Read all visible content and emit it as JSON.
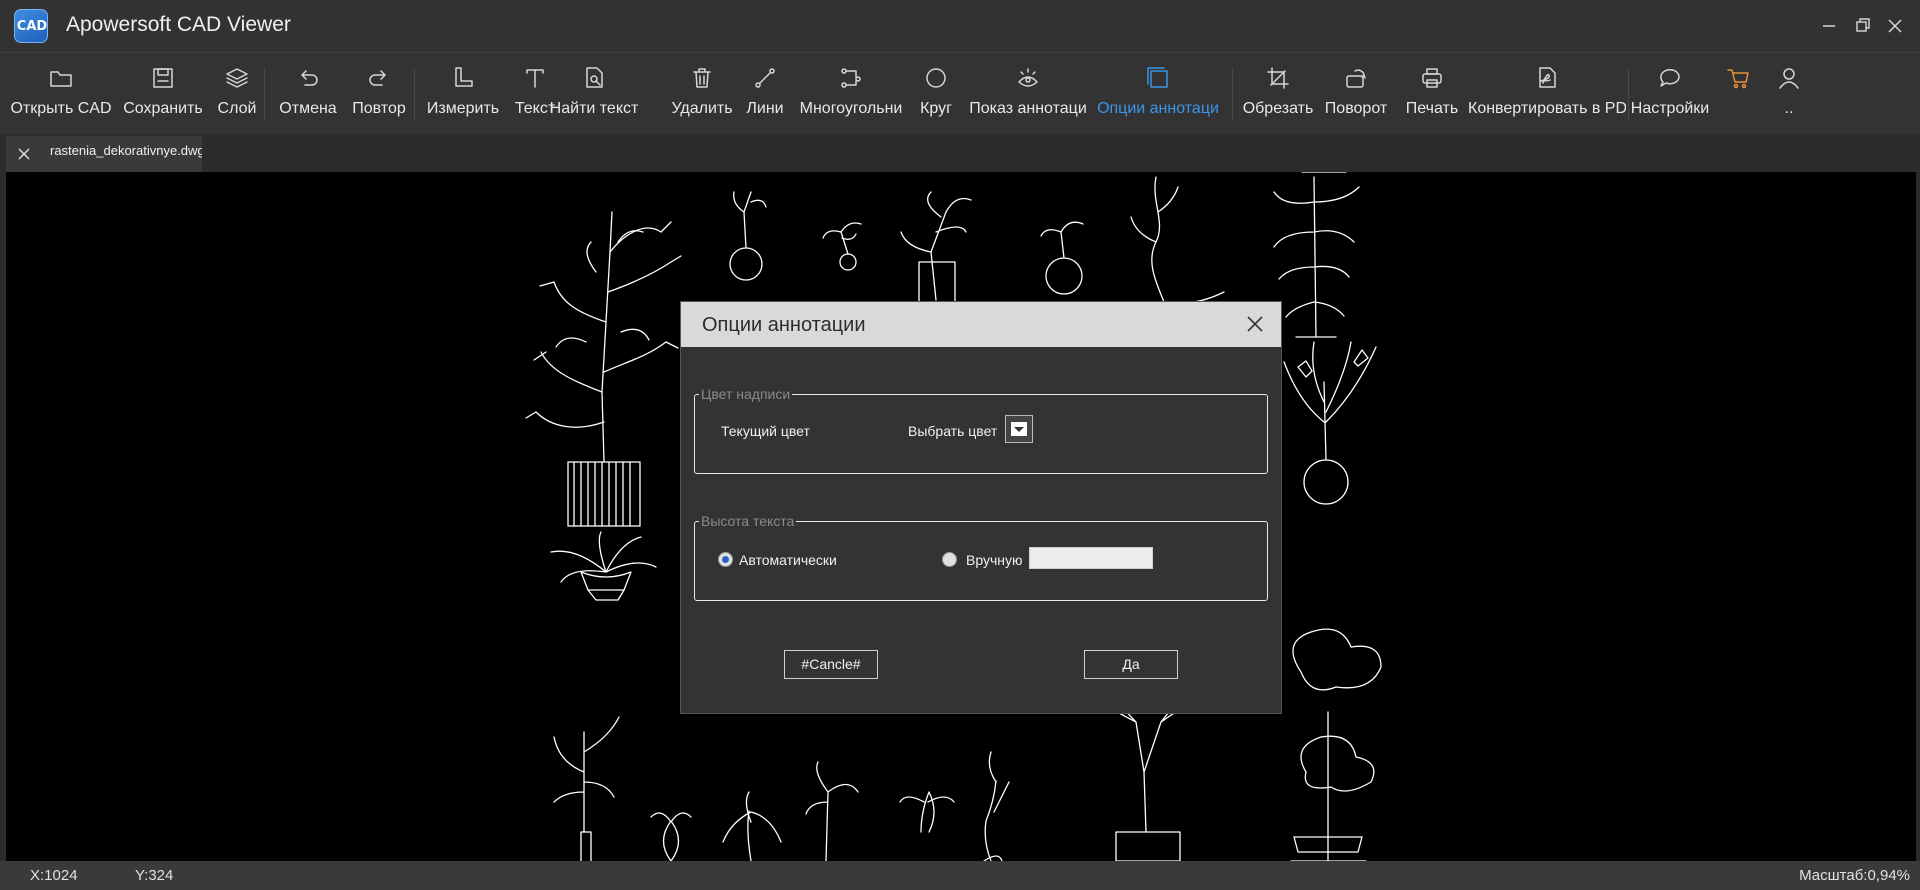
{
  "window": {
    "title": "Apowersoft CAD Viewer",
    "logo_text": "CAD"
  },
  "toolbar": {
    "items": [
      {
        "label": "Открыть CAD",
        "icon": "folder-icon"
      },
      {
        "label": "Сохранить",
        "icon": "save-icon"
      },
      {
        "label": "Слой",
        "icon": "layers-icon"
      },
      {
        "label": "Отмена",
        "icon": "undo-icon"
      },
      {
        "label": "Повтор",
        "icon": "redo-icon"
      },
      {
        "label": "Измерить",
        "icon": "measure-icon"
      },
      {
        "label": "Текст",
        "icon": "text-icon"
      },
      {
        "label": "Найти текст",
        "icon": "find-text-icon"
      },
      {
        "label": "Удалить",
        "icon": "trash-icon"
      },
      {
        "label": "Лини",
        "icon": "line-icon"
      },
      {
        "label": "Многоугольни",
        "icon": "polygon-icon"
      },
      {
        "label": "Круг",
        "icon": "circle-icon"
      },
      {
        "label": "Показ аннотаци",
        "icon": "show-annotation-icon"
      },
      {
        "label": "Опции аннотаци",
        "icon": "annotation-options-icon",
        "active": true
      },
      {
        "label": "Обрезать",
        "icon": "crop-icon"
      },
      {
        "label": "Поворот",
        "icon": "rotate-icon"
      },
      {
        "label": "Печать",
        "icon": "print-icon"
      },
      {
        "label": "Конвертировать в PD",
        "icon": "pdf-icon"
      },
      {
        "label": "Настройки",
        "icon": "settings-chat-icon"
      },
      {
        "label": "",
        "icon": "cart-icon"
      },
      {
        "label": "..",
        "icon": "user-icon"
      }
    ],
    "accent_color": "#3d95e8",
    "cart_color": "#e8923a"
  },
  "tab": {
    "title": "rastenia_dekorativnye.dwg"
  },
  "status": {
    "x": "X:1024",
    "y": "Y:324",
    "zoom": "Масштаб:0,94%"
  },
  "dialog": {
    "title": "Опции аннотации",
    "color_group": {
      "legend": "Цвет надписи",
      "current_color_label": "Текущий цвет",
      "choose_color_label": "Выбрать цвет"
    },
    "height_group": {
      "legend": "Высота текста",
      "auto_label": "Автоматически",
      "manual_label": "Вручную",
      "manual_value": "",
      "selected": "auto"
    },
    "cancel_label": "#Cancle#",
    "ok_label": "Да"
  }
}
